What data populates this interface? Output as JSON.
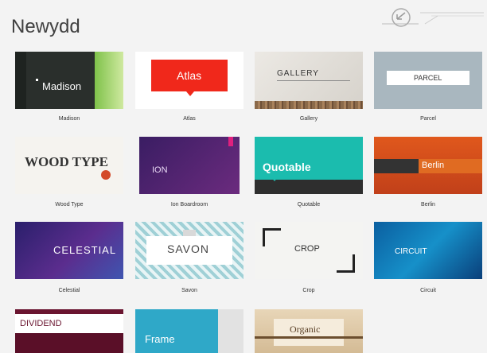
{
  "header": {
    "title": "Newydd"
  },
  "themes": [
    {
      "name": "Madison",
      "label": "Madison"
    },
    {
      "name": "Atlas",
      "label": "Atlas"
    },
    {
      "name": "Gallery",
      "label": "GALLERY"
    },
    {
      "name": "Parcel",
      "label": "PARCEL"
    },
    {
      "name": "Wood Type",
      "label": "WOOD TYPE"
    },
    {
      "name": "Ion Boardroom",
      "label": "ION"
    },
    {
      "name": "Quotable",
      "label": "Quotable"
    },
    {
      "name": "Berlin",
      "label": "Berlin"
    },
    {
      "name": "Celestial",
      "label": "CELESTIAL"
    },
    {
      "name": "Savon",
      "label": "SAVON"
    },
    {
      "name": "Crop",
      "label": "CROP"
    },
    {
      "name": "Circuit",
      "label": "CIRCUIT"
    },
    {
      "name": "Dividend",
      "label": "DIVIDEND"
    },
    {
      "name": "Frame",
      "label": "Frame"
    },
    {
      "name": "Organic",
      "label": "Organic"
    }
  ]
}
